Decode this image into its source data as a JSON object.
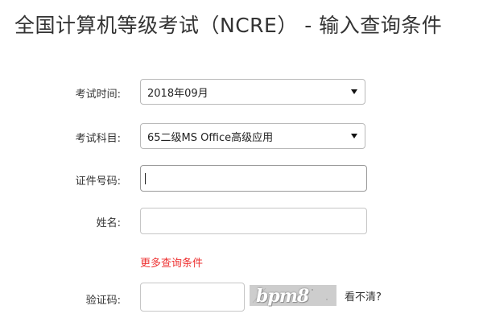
{
  "page": {
    "title": "全国计算机等级考试（NCRE） - 输入查询条件"
  },
  "form": {
    "exam_time": {
      "label": "考试时间:",
      "value": "2018年09月"
    },
    "exam_subject": {
      "label": "考试科目:",
      "value": "65二级MS Office高级应用"
    },
    "id_number": {
      "label": "证件号码:",
      "value": ""
    },
    "name": {
      "label": "姓名:",
      "value": ""
    },
    "more_conditions": "更多查询条件",
    "captcha": {
      "label": "验证码:",
      "value": "",
      "image_text": "bpm8",
      "refresh_label": "看不清?"
    }
  },
  "colors": {
    "link_red": "#e33333",
    "captcha_bg": "#cfcfcf"
  }
}
